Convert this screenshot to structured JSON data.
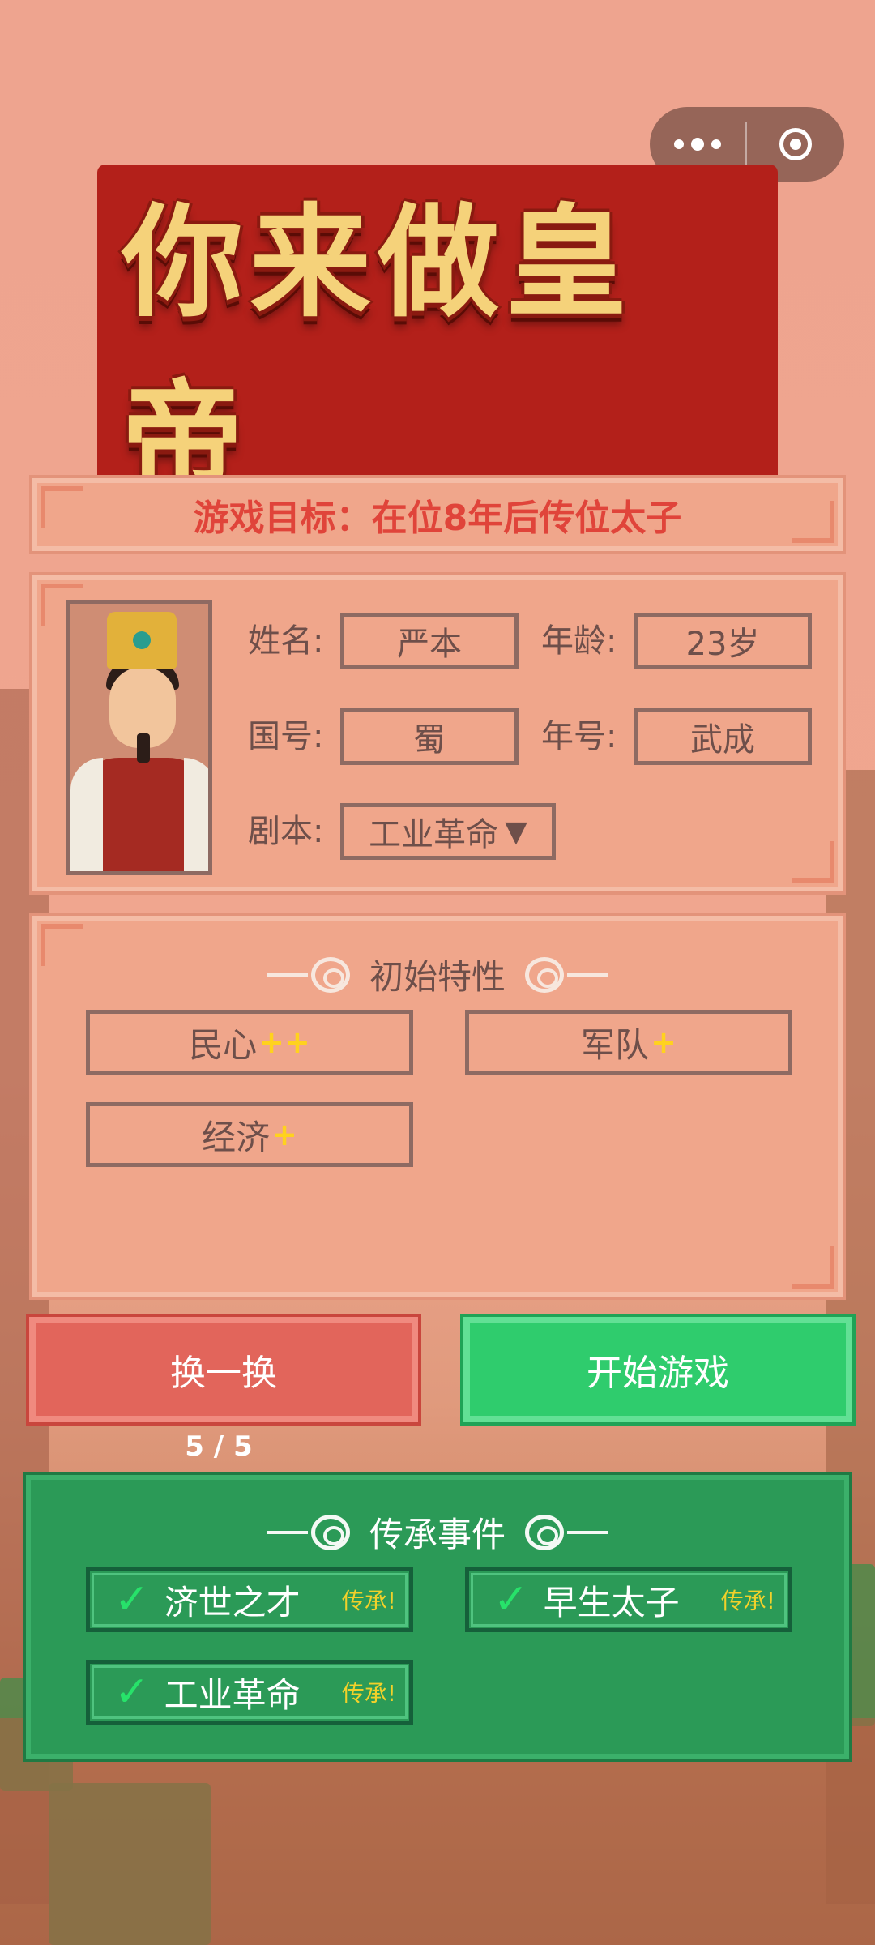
{
  "title": "你来做皇帝",
  "goal": "游戏目标：在位8年后传位太子",
  "profile": {
    "name_label": "姓名:",
    "name_value": "严本",
    "age_label": "年龄:",
    "age_value": "23岁",
    "country_label": "国号:",
    "country_value": "蜀",
    "era_label": "年号:",
    "era_value": "武成",
    "script_label": "剧本:",
    "script_value": "工业革命",
    "script_arrow": "▼"
  },
  "traits": {
    "title": "初始特性",
    "items": [
      {
        "label": "民心",
        "plus": "++"
      },
      {
        "label": "军队",
        "plus": "+"
      },
      {
        "label": "经济",
        "plus": "+"
      }
    ]
  },
  "buttons": {
    "swap": "换一换",
    "start": "开始游戏",
    "counter": "5 / 5"
  },
  "legacy": {
    "title": "传承事件",
    "tag": "传承!",
    "items": [
      "济世之才",
      "早生太子",
      "工业革命"
    ]
  },
  "colors": {
    "background": "#eea48f",
    "accent_red": "#e2655b",
    "accent_green": "#2fcc6d",
    "legacy_green": "#2b9a57",
    "plus_yellow": "#ffd21e"
  }
}
